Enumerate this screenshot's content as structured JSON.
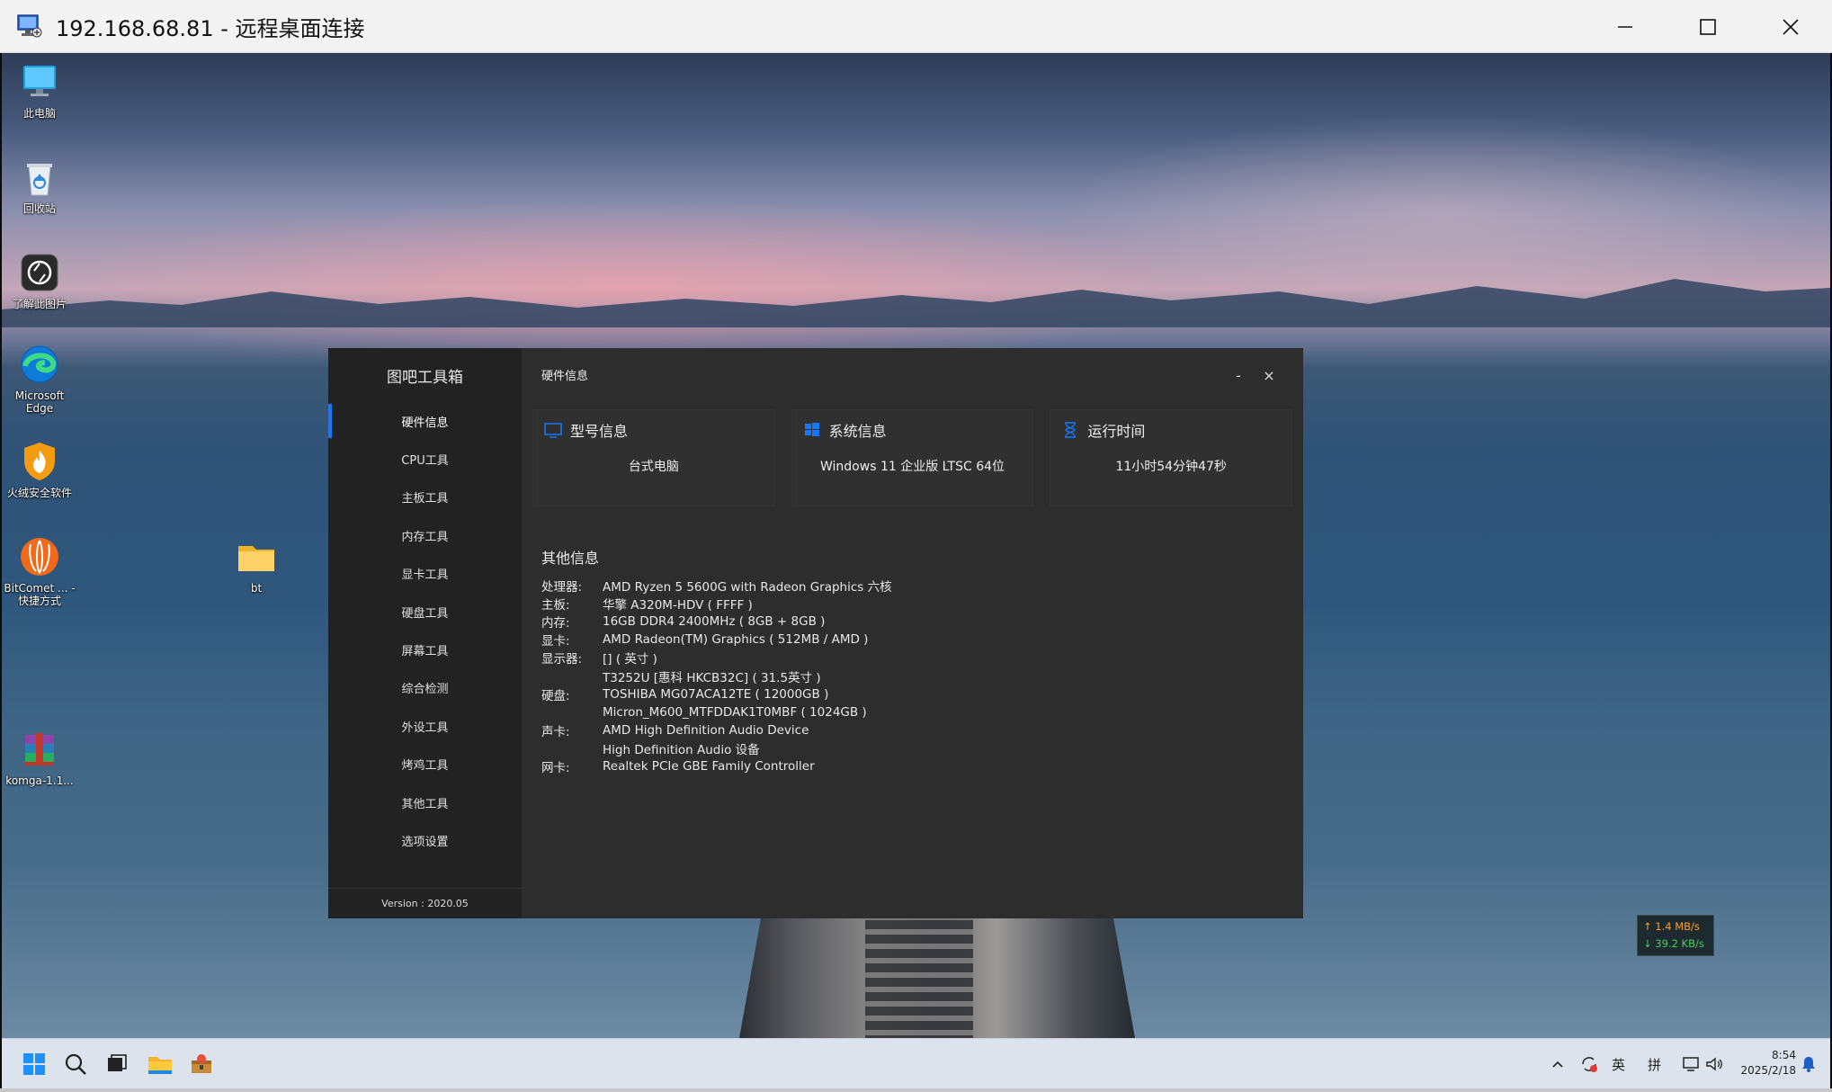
{
  "rdp": {
    "title": "192.168.68.81 - 远程桌面连接"
  },
  "desktop_icons": [
    {
      "label": "此电脑"
    },
    {
      "label": "回收站"
    },
    {
      "label": "了解此图片"
    },
    {
      "label": "Microsoft Edge"
    },
    {
      "label": "火绒安全软件"
    },
    {
      "label": "BitComet ... - 快捷方式"
    },
    {
      "label": "bt"
    },
    {
      "label": "komga-1.1..."
    }
  ],
  "app": {
    "title": "图吧工具箱",
    "page_title": "硬件信息",
    "minimize_label": "-",
    "close_label": "×",
    "version": "Version : 2020.05",
    "sidebar": [
      {
        "label": "硬件信息"
      },
      {
        "label": "CPU工具"
      },
      {
        "label": "主板工具"
      },
      {
        "label": "内存工具"
      },
      {
        "label": "显卡工具"
      },
      {
        "label": "硬盘工具"
      },
      {
        "label": "屏幕工具"
      },
      {
        "label": "综合检测"
      },
      {
        "label": "外设工具"
      },
      {
        "label": "烤鸡工具"
      },
      {
        "label": "其他工具"
      },
      {
        "label": "选项设置"
      }
    ],
    "cards": [
      {
        "title": "型号信息",
        "value": "台式电脑",
        "icon": "monitor-icon"
      },
      {
        "title": "系统信息",
        "value": "Windows 11 企业版 LTSC 64位",
        "icon": "windows-logo-icon"
      },
      {
        "title": "运行时间",
        "value": "11小时54分钟47秒",
        "icon": "hourglass-icon"
      }
    ],
    "other_title": "其他信息",
    "other_info": [
      {
        "k": "处理器:",
        "v": "AMD Ryzen 5 5600G with Radeon Graphics 六核"
      },
      {
        "k": "主板:",
        "v": "华擎 A320M-HDV ( FFFF )"
      },
      {
        "k": "内存:",
        "v": "16GB DDR4 2400MHz ( 8GB + 8GB )"
      },
      {
        "k": "显卡:",
        "v": "AMD Radeon(TM) Graphics ( 512MB / AMD )"
      },
      {
        "k": "显示器:",
        "v": "[] ( 英寸 )"
      },
      {
        "k": "",
        "v": "T3252U [惠科 HKCB32C] ( 31.5英寸 )"
      },
      {
        "k": "硬盘:",
        "v": "TOSHIBA MG07ACA12TE ( 12000GB )"
      },
      {
        "k": "",
        "v": "Micron_M600_MTFDDAK1T0MBF ( 1024GB )"
      },
      {
        "k": "声卡:",
        "v": "AMD High Definition Audio Device"
      },
      {
        "k": "",
        "v": "High Definition Audio 设备"
      },
      {
        "k": "网卡:",
        "v": "Realtek PCIe GBE Family Controller"
      }
    ]
  },
  "netspeed": {
    "up": "↑ 1.4 MB/s",
    "down": "↓ 39.2 KB/s"
  },
  "taskbar": {
    "ime_lang": "英",
    "ime_mode": "拼",
    "time": "8:54",
    "date": "2025/2/18"
  },
  "colors": {
    "accent": "#1677ff",
    "sidebar_bg": "#222222",
    "main_bg": "#2d2d2d"
  }
}
